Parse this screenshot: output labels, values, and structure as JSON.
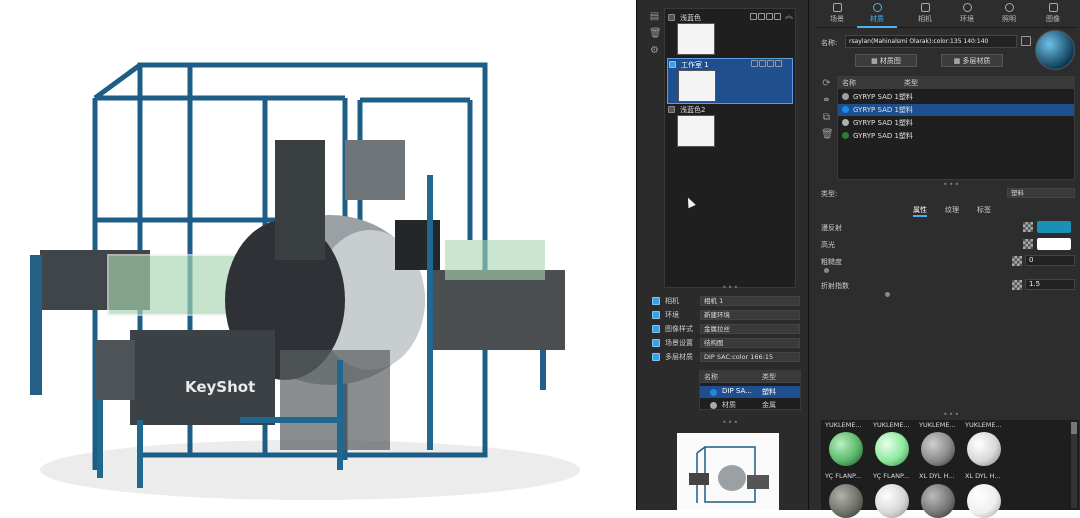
{
  "viewport": {
    "watermark": "KeyShot"
  },
  "scene_tree": {
    "items": [
      {
        "label": "浅蓝色",
        "selected": false
      },
      {
        "label": "工作室 1",
        "selected": true
      },
      {
        "label": "浅蓝色2",
        "selected": false
      }
    ],
    "studio_rows": [
      {
        "label": "相机",
        "value": "相机 1"
      },
      {
        "label": "环境",
        "value": "新建环境"
      },
      {
        "label": "图像样式",
        "value": "金属拉丝"
      },
      {
        "label": "场景设置",
        "value": "结构图"
      },
      {
        "label": "多层材质",
        "value": "DIP SAC:color 166:15"
      }
    ],
    "layer_table": {
      "headers": [
        "名称",
        "类型"
      ],
      "rows": [
        {
          "name": "DIP SA...",
          "type": "塑料",
          "selected": true
        },
        {
          "name": "材质",
          "type": "金属",
          "selected": false
        }
      ]
    }
  },
  "tabs": [
    {
      "label": "场景",
      "active": false
    },
    {
      "label": "材质",
      "active": true
    },
    {
      "label": "相机",
      "active": false
    },
    {
      "label": "环境",
      "active": false
    },
    {
      "label": "照明",
      "active": false
    },
    {
      "label": "图像",
      "active": false
    }
  ],
  "material": {
    "name_label": "名称:",
    "name_value": "rsaylan(Mahinalsmi Olarak):color:135 140:140",
    "material_graph_button": "材质图",
    "multi_layer_button": "多层材质",
    "list_headers": [
      "名称",
      "类型"
    ],
    "list": [
      {
        "name": "GYRYP SAD 1塑料",
        "selected": false,
        "color": "#9e9e9e"
      },
      {
        "name": "GYRYP SAD 1塑料",
        "selected": true,
        "color": "#1e88e5"
      },
      {
        "name": "GYRYP SAD 1塑料",
        "selected": false,
        "color": "#b0b0b0"
      },
      {
        "name": "GYRYP SAD 1塑料",
        "selected": false,
        "color": "#2e7d32"
      }
    ],
    "type_label": "类型:",
    "type_value": "塑料",
    "subtabs": [
      "属性",
      "纹理",
      "标签"
    ],
    "props": [
      {
        "label": "漫反射",
        "kind": "color",
        "color": "#1a8fb8"
      },
      {
        "label": "高光",
        "kind": "color",
        "color": "#ffffff"
      },
      {
        "label": "粗糙度",
        "kind": "number",
        "value": "0"
      },
      {
        "label": "折射指数",
        "kind": "number",
        "value": "1.5"
      }
    ]
  },
  "library": {
    "row1": [
      {
        "name": "YUKLEME...",
        "color": "#5cb86a"
      },
      {
        "name": "YUKLEME...",
        "color": "#8ce89a"
      },
      {
        "name": "YUKLEME...",
        "color": "#8a8a8a"
      },
      {
        "name": "YUKLEME...",
        "color": "#d8d8d8"
      }
    ],
    "row2": [
      {
        "name": "YÇ FLANP...",
        "color": "#6f7268"
      },
      {
        "name": "YÇ FLANP...",
        "color": "#d7d7d7"
      },
      {
        "name": "XL DYL H...",
        "color": "#777777"
      },
      {
        "name": "XL DYL H...",
        "color": "#efefef"
      }
    ]
  }
}
